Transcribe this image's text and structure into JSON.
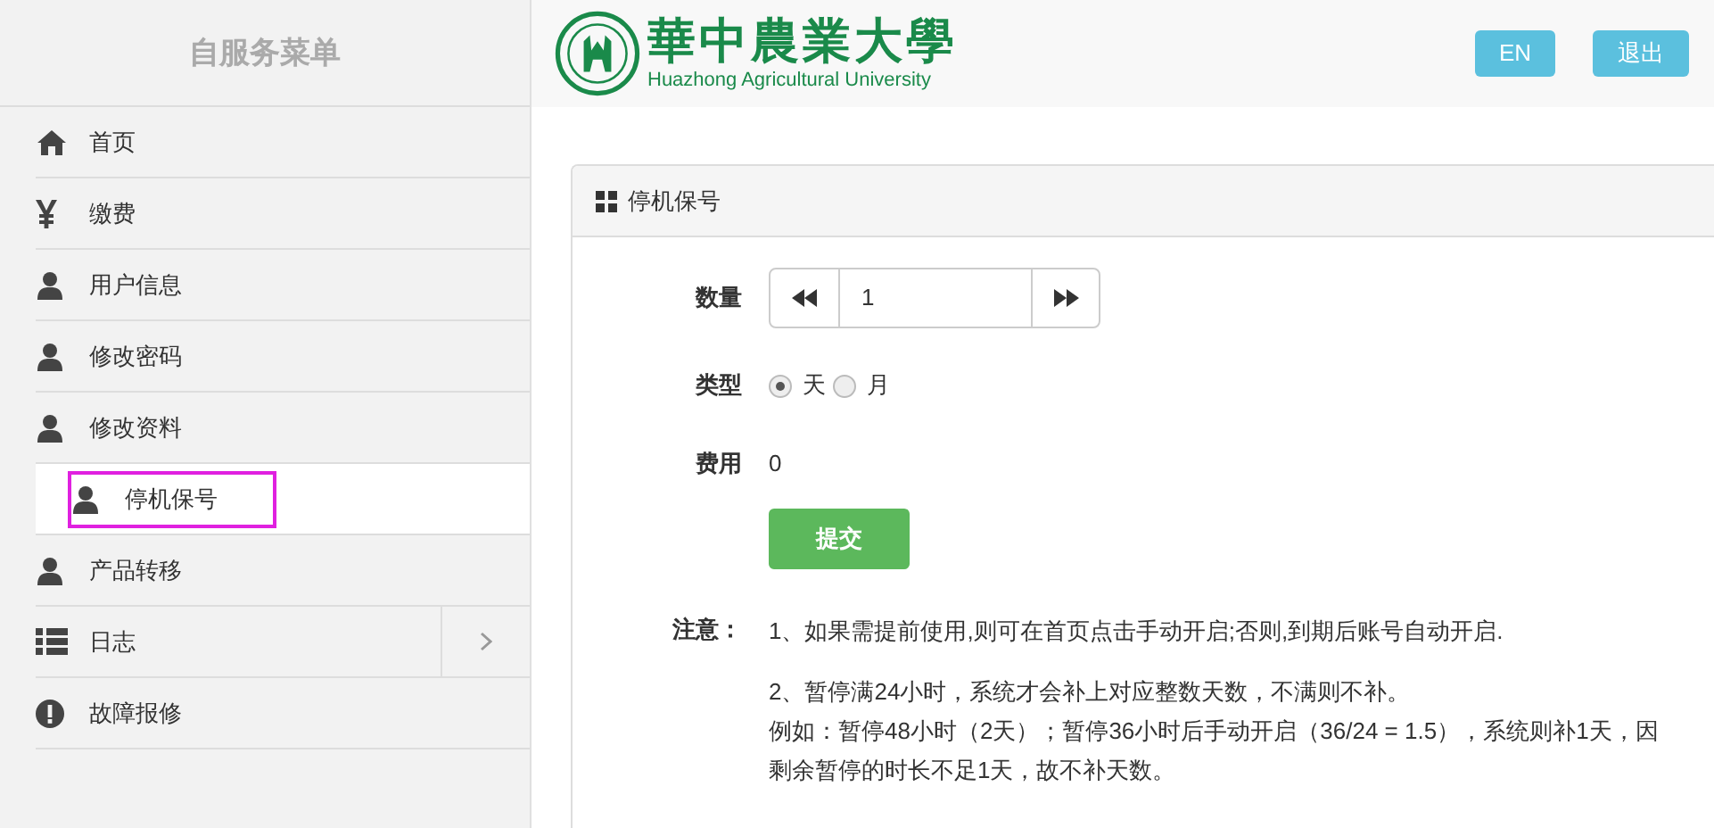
{
  "sidebar": {
    "title": "自服务菜单",
    "items": [
      {
        "label": "首页",
        "selected": false
      },
      {
        "label": "缴费",
        "selected": false
      },
      {
        "label": "用户信息",
        "selected": false
      },
      {
        "label": "修改密码",
        "selected": false
      },
      {
        "label": "修改资料",
        "selected": false
      },
      {
        "label": "停机保号",
        "selected": true
      },
      {
        "label": "产品转移",
        "selected": false
      },
      {
        "label": "日志",
        "selected": false,
        "expandable": true
      },
      {
        "label": "故障报修",
        "selected": false
      }
    ]
  },
  "header": {
    "logo_cn": "華中農業大學",
    "logo_en": "Huazhong Agricultural University",
    "buttons": [
      "EN",
      "退出"
    ]
  },
  "panel": {
    "title": "停机保号",
    "quantity": {
      "label": "数量",
      "value": "1"
    },
    "type": {
      "label": "类型",
      "options": [
        {
          "label": "天",
          "selected": true
        },
        {
          "label": "月",
          "selected": false
        }
      ]
    },
    "fee": {
      "label": "费用",
      "value": "0"
    },
    "submit": "提交",
    "note": {
      "label": "注意：",
      "paragraphs": [
        [
          "1、如果需提前使用,则可在首页点击手动开启;否则,到期后账号自动开启."
        ],
        [
          "2、暂停满24小时，系统才会补上对应整数天数，不满则不补。",
          "例如：暂停48小时（2天）；暂停36小时后手动开启（36/24 = 1.5），系统则补1天，因剩余暂停的时长不足1天，故不补天数。"
        ]
      ]
    }
  }
}
